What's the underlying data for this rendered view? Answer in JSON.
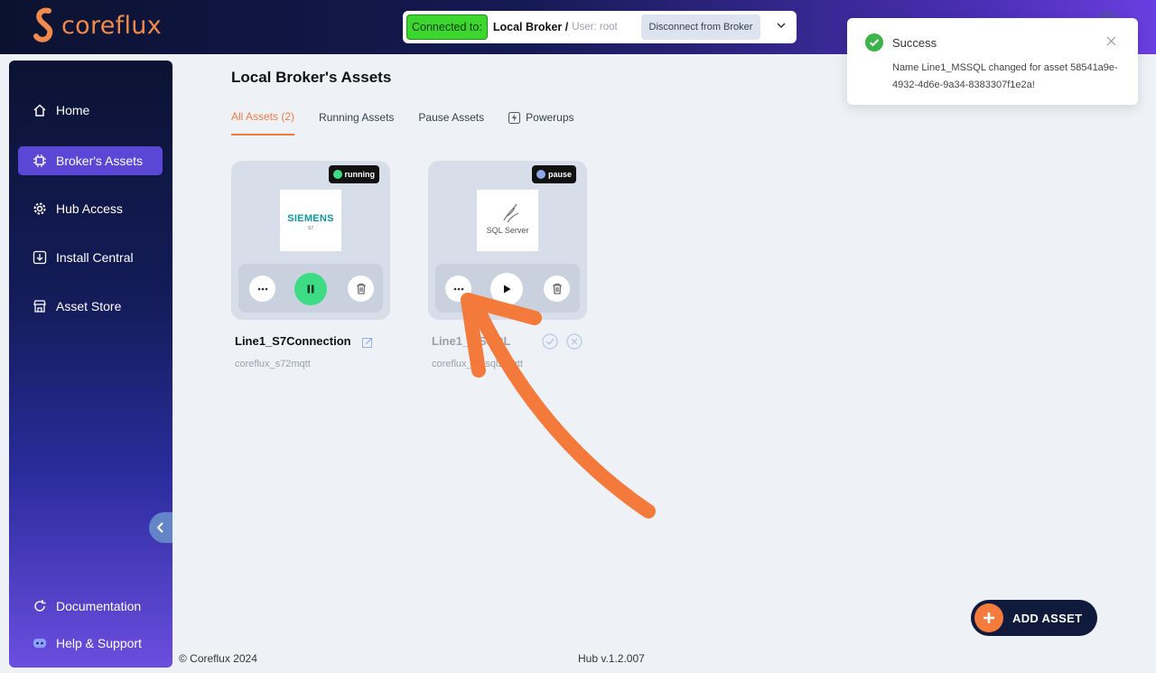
{
  "app": {
    "brand": "coreflux"
  },
  "connection": {
    "badge": "Connected to:",
    "broker": "Local Broker /",
    "user": "User: root",
    "disconnect_label": "Disconnect from Broker"
  },
  "sidebar": {
    "items": [
      {
        "label": "Home",
        "icon": "home-icon"
      },
      {
        "label": "Broker's Assets",
        "icon": "chip-icon",
        "active": true
      },
      {
        "label": "Hub Access",
        "icon": "gear-icon"
      },
      {
        "label": "Install Central",
        "icon": "download-icon"
      },
      {
        "label": "Asset Store",
        "icon": "store-icon"
      }
    ],
    "bottom": [
      {
        "label": "Documentation",
        "icon": "refresh-icon"
      },
      {
        "label": "Help & Support",
        "icon": "discord-icon"
      }
    ]
  },
  "main": {
    "title": "Local Broker's Assets",
    "tabs": [
      {
        "label": "All Assets (2)",
        "active": true
      },
      {
        "label": "Running Assets"
      },
      {
        "label": "Pause Assets"
      },
      {
        "label": "Powerups",
        "icon": "lightning-icon"
      }
    ],
    "assets": [
      {
        "status": "running",
        "status_color": "#3ddc84",
        "logo_text": "SIEMENS",
        "logo_sub": "S7",
        "name": "Line1_S7Connection",
        "subtitle": "coreflux_s72mqtt",
        "primary_action": "pause"
      },
      {
        "status": "pause",
        "status_color": "#8ea6e6",
        "logo_text": "SQL Server",
        "name": "Line1_MSSQL",
        "subtitle": "coreflux_mssql2mqtt",
        "primary_action": "play"
      }
    ]
  },
  "toast": {
    "title": "Success",
    "message": "Name Line1_MSSQL changed for asset 58541a9e-4932-4d6e-9a34-8383307f1e2a!",
    "accent": "#3bb54a"
  },
  "add_asset": {
    "label": "ADD ASSET"
  },
  "footer": {
    "copyright": "© Coreflux 2024",
    "version": "Hub v.1.2.007"
  },
  "colors": {
    "accent": "#f07a40",
    "sidebar_active": "#5b47d6",
    "connected": "#3dd62e"
  }
}
